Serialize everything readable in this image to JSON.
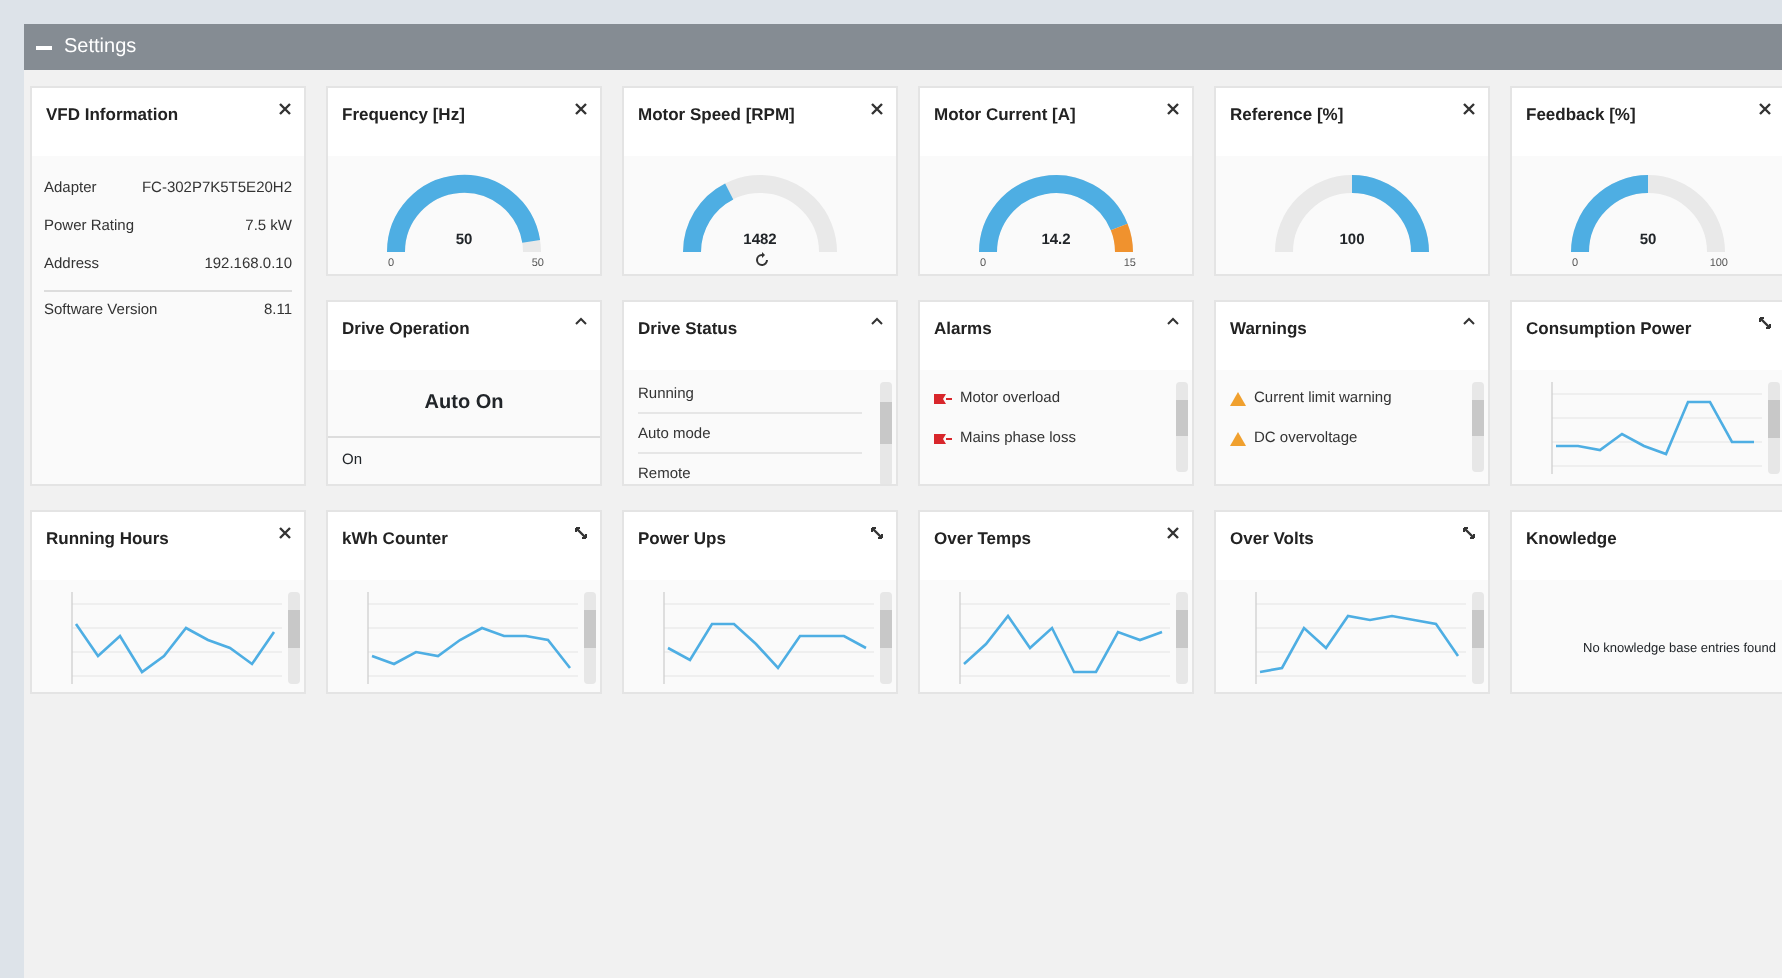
{
  "header": {
    "title": "Settings"
  },
  "info": {
    "title": "VFD Information",
    "rows": [
      {
        "label": "Adapter",
        "value": "FC-302P7K5T5E20H2"
      },
      {
        "label": "Power Rating",
        "value": "7.5 kW"
      },
      {
        "label": "Address",
        "value": "192.168.0.10"
      },
      {
        "label": "Software Version",
        "value": "8.11"
      }
    ]
  },
  "gauges": [
    {
      "title": "Frequency [Hz]",
      "kind": "normal",
      "value": "50",
      "min": "0",
      "max": "50"
    },
    {
      "title": "Motor Speed [RPM]",
      "kind": "normal",
      "value": "1482",
      "refresh": true
    },
    {
      "title": "Motor Current [A]",
      "kind": "normal",
      "value": "14.2",
      "min": "0",
      "max": "15"
    },
    {
      "title": "Reference [%]",
      "kind": "bipolar",
      "value": "100"
    },
    {
      "title": "Feedback [%]",
      "kind": "normal",
      "value": "50",
      "min": "0",
      "max": "100"
    }
  ],
  "operation": {
    "title": "Drive Operation",
    "mode": "Auto On",
    "state": "On"
  },
  "status": {
    "title": "Drive Status",
    "items": [
      "Running",
      "Auto mode",
      "Remote"
    ]
  },
  "alarms": {
    "title": "Alarms",
    "items": [
      {
        "kind": "alarm",
        "text": "Motor overload"
      },
      {
        "kind": "alarm",
        "text": "Mains phase loss"
      }
    ]
  },
  "warnings": {
    "title": "Warnings",
    "items": [
      {
        "kind": "warning",
        "text": "Current limit warning"
      },
      {
        "kind": "warning",
        "text": "DC overvoltage"
      }
    ]
  },
  "charts": [
    {
      "title": "Consumption Power",
      "closable": false
    },
    {
      "title": "Running Hours",
      "closable": true
    },
    {
      "title": "kWh Counter",
      "closable": false
    },
    {
      "title": "Power Ups",
      "closable": false
    },
    {
      "title": "Over Temps",
      "closable": true
    },
    {
      "title": "Over Volts",
      "closable": false
    }
  ],
  "knowledge": {
    "title": "Knowledge",
    "message": "No knowledge base entries found"
  }
}
